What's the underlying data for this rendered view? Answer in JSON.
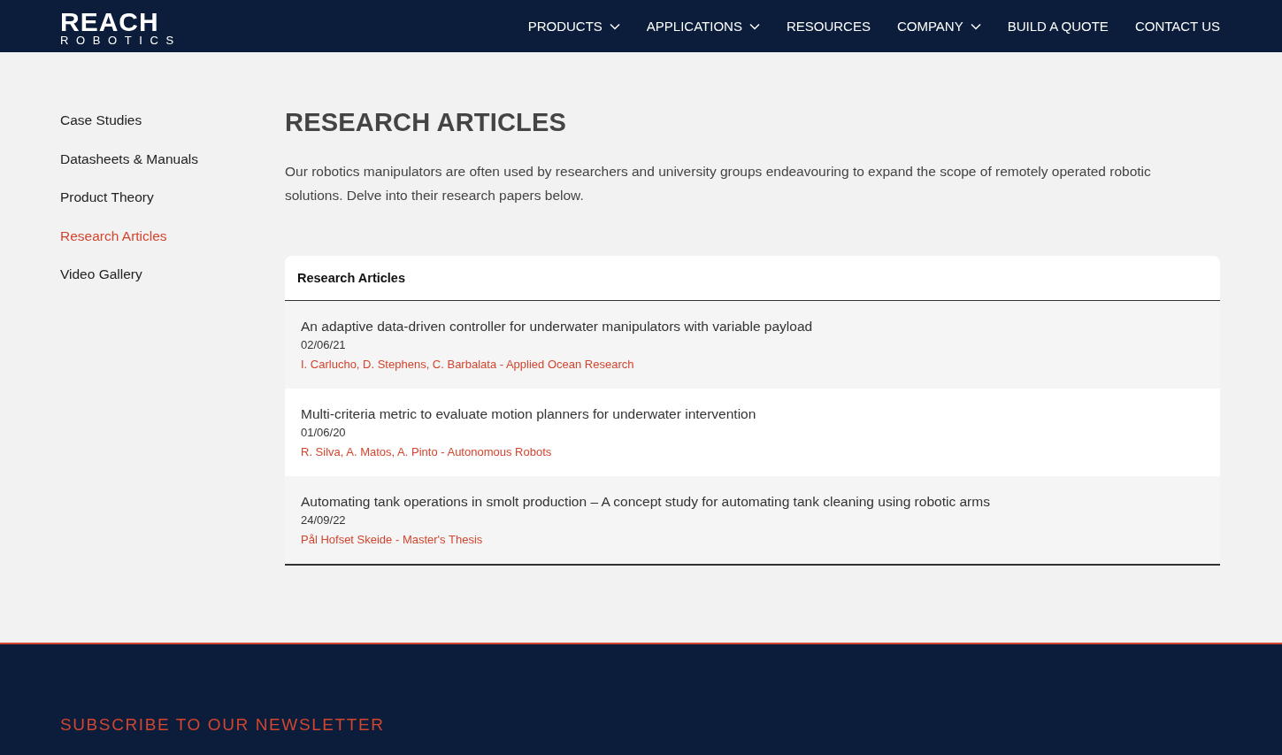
{
  "header": {
    "logo": {
      "wordmark": "REACH",
      "subtitle": "ROBOTICS"
    },
    "nav": [
      {
        "label": "PRODUCTS",
        "dropdown": true
      },
      {
        "label": "APPLICATIONS",
        "dropdown": true
      },
      {
        "label": "RESOURCES",
        "dropdown": false
      },
      {
        "label": "COMPANY",
        "dropdown": true
      },
      {
        "label": "BUILD A QUOTE",
        "dropdown": false
      },
      {
        "label": "CONTACT US",
        "dropdown": false
      }
    ]
  },
  "sidebar": {
    "items": [
      {
        "label": "Case Studies",
        "selected": false
      },
      {
        "label": "Datasheets & Manuals",
        "selected": false
      },
      {
        "label": "Product Theory",
        "selected": false
      },
      {
        "label": "Research Articles",
        "selected": true
      },
      {
        "label": "Video Gallery",
        "selected": false
      }
    ]
  },
  "main": {
    "title": "RESEARCH ARTICLES",
    "intro": "Our robotics manipulators are often used by researchers and university groups endeavouring to expand the scope of remotely operated robotic solutions. Delve into their research papers below.",
    "table": {
      "heading": "Research Articles",
      "rows": [
        {
          "title": "An adaptive data-driven controller for underwater manipulators with variable payload",
          "date": "02/06/21",
          "source": "I. Carlucho, D. Stephens, C. Barbalata - Applied Ocean Research"
        },
        {
          "title": "Multi-criteria metric to evaluate motion planners for underwater intervention",
          "date": "01/06/20",
          "source": "R. Silva, A. Matos, A. Pinto - Autonomous Robots"
        },
        {
          "title": "Automating tank operations in smolt production – A concept study for automating tank cleaning using robotic arms",
          "date": "24/09/22",
          "source": "Pål Hofset Skeide - Master's Thesis"
        }
      ]
    }
  },
  "footer": {
    "newsletter_heading": "SUBSCRIBE TO OUR NEWSLETTER"
  }
}
